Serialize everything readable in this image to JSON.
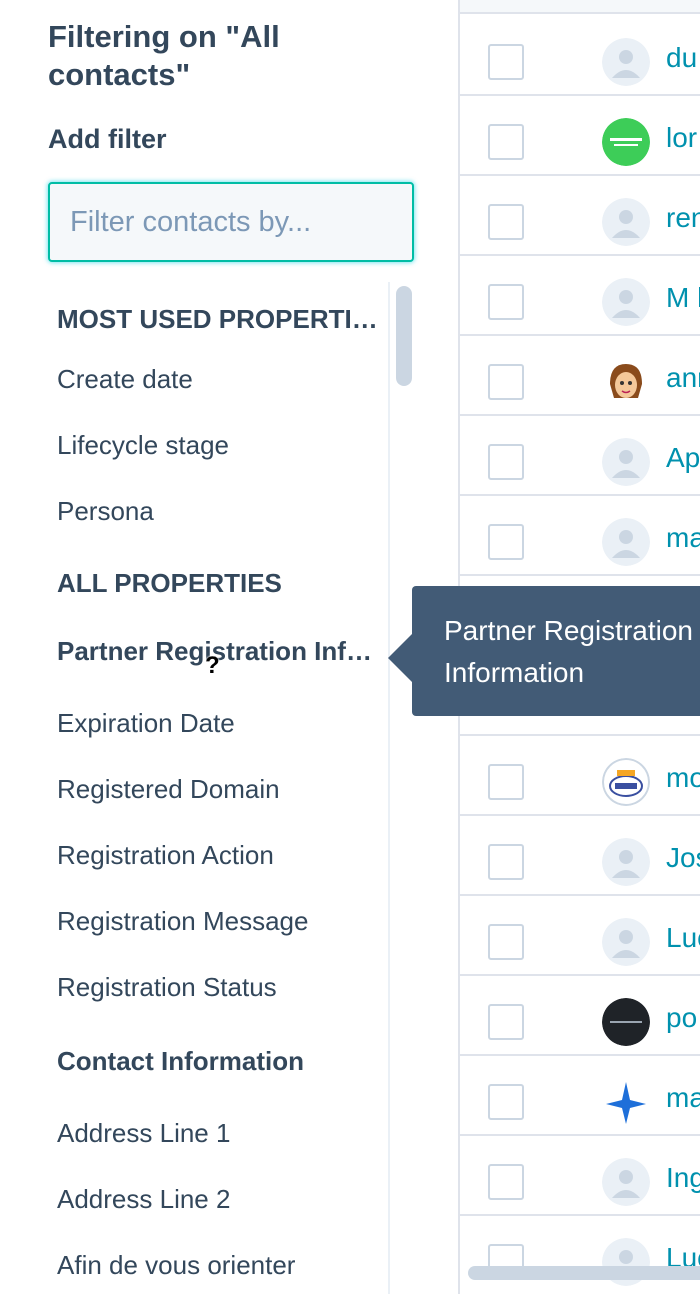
{
  "panel": {
    "title": "Filtering on \"All contacts\"",
    "add_filter": "Add filter",
    "search_placeholder": "Filter contacts by..."
  },
  "properties": {
    "most_used_header": "MOST USED PROPERTIES",
    "most_used": [
      "Create date",
      "Lifecycle stage",
      "Persona"
    ],
    "all_header": "ALL PROPERTIES",
    "group1_header": "Partner Registration Information",
    "group1": [
      "Expiration Date",
      "Registered Domain",
      "Registration Action",
      "Registration Message",
      "Registration Status"
    ],
    "group2_header": "Contact Information",
    "group2": [
      "Address Line 1",
      "Address Line 2",
      "Afin de vous orienter"
    ]
  },
  "tooltip": {
    "text": "Partner Registration Information"
  },
  "contacts": [
    {
      "name": "du",
      "avatar": "default"
    },
    {
      "name": "lor",
      "avatar": "schneider-logo"
    },
    {
      "name": "ren",
      "avatar": "default"
    },
    {
      "name": "M l",
      "avatar": "default"
    },
    {
      "name": "ann",
      "avatar": "cartoon-face"
    },
    {
      "name": "Ap",
      "avatar": "default"
    },
    {
      "name": "ma",
      "avatar": "default"
    },
    {
      "name": "mo",
      "avatar": "mae-logo"
    },
    {
      "name": "Jos",
      "avatar": "default"
    },
    {
      "name": "Luc",
      "avatar": "default"
    },
    {
      "name": "po",
      "avatar": "invivox-logo"
    },
    {
      "name": "ma",
      "avatar": "star-logo"
    },
    {
      "name": "Ing",
      "avatar": "default"
    },
    {
      "name": "Luc",
      "avatar": "default"
    }
  ],
  "colors": {
    "accent": "#00bda5",
    "link": "#0091ae",
    "tooltip_bg": "#425b76",
    "text": "#33475b"
  }
}
